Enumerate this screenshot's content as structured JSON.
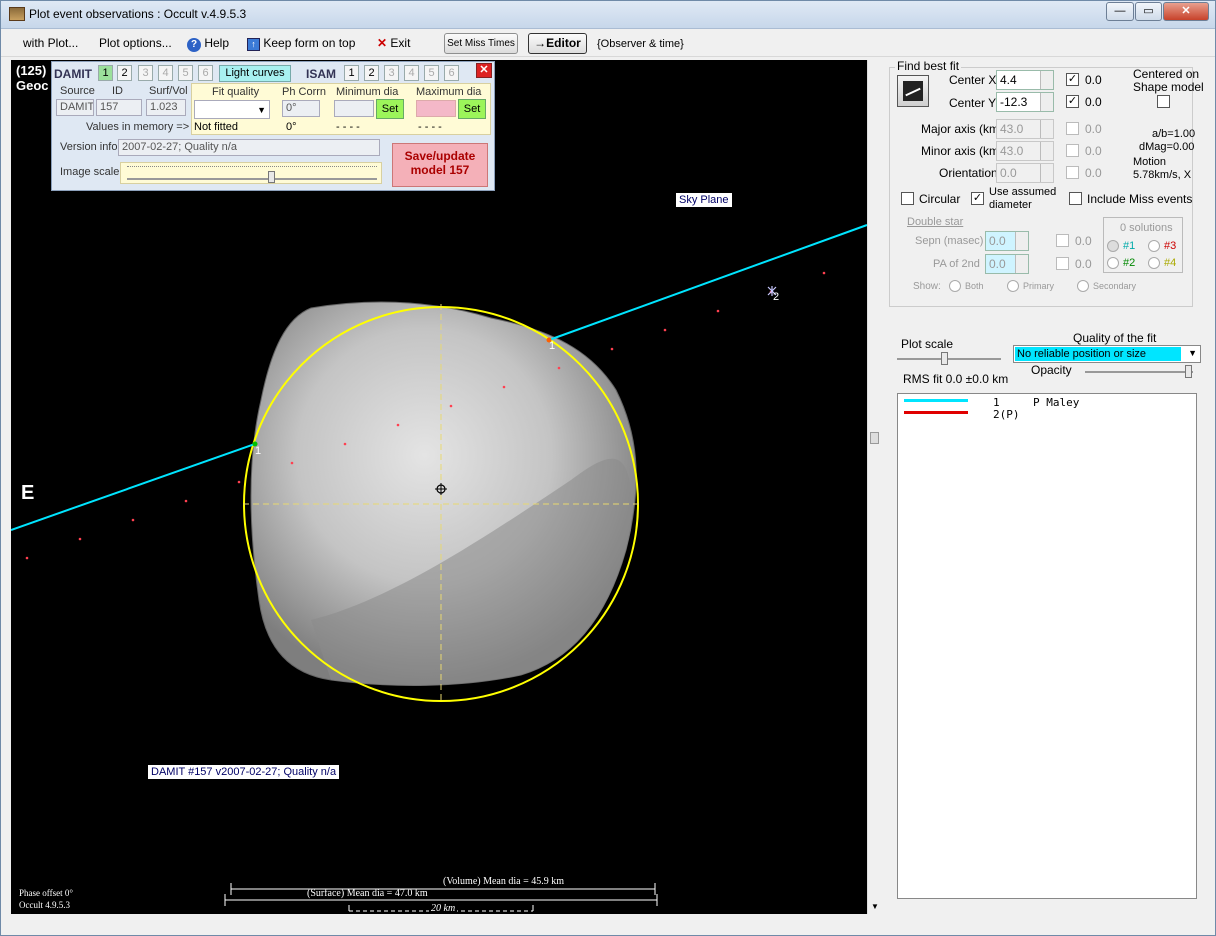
{
  "window": {
    "title": "Plot event observations : Occult v.4.9.5.3"
  },
  "menu": {
    "with_plot": "with Plot...",
    "plot_options": "Plot options...",
    "help": "Help",
    "keep_on_top": "Keep form on top",
    "exit": "Exit",
    "set_miss_times": "Set Miss Times",
    "editor": "→Editor",
    "observer_time": "{Observer & time}"
  },
  "plot": {
    "asteroid_id": "(125)",
    "geoc": "Geoc",
    "sky_plane": "Sky Plane",
    "east": "E",
    "chord1_label": "1",
    "chord1_label_b": "1",
    "chord2_label": "2",
    "model_caption": "DAMIT #157 v2007-02-27; Quality n/a",
    "volume_mean": "(Volume) Mean dia = 45.9 km",
    "surface_mean": "(Surface) Mean dia = 47.0 km",
    "scale_bar": "20 km",
    "phase_offset": "Phase offset 0°",
    "version": "Occult 4.9.5.3"
  },
  "damit": {
    "label": "DAMIT",
    "buttons": [
      "1",
      "2",
      "3",
      "4",
      "5",
      "6"
    ],
    "light_curves": "Light curves",
    "isam_label": "ISAM",
    "isam_buttons": [
      "1",
      "2",
      "3",
      "4",
      "5",
      "6"
    ],
    "close": "✕",
    "source_label": "Source",
    "id_label": "ID",
    "surfvol_label": "Surf/Vol",
    "source": "DAMIT",
    "id": "157",
    "surfvol": "1.023",
    "fit_quality_label": "Fit quality",
    "ph_corr_label": "Ph Corrn",
    "min_dia_label": "Minimum dia",
    "max_dia_label": "Maximum dia",
    "ph_corr_value": "0°",
    "set_label": "Set",
    "values_in_memory": "Values in memory =>",
    "not_fitted": "Not fitted",
    "mem_ph": "0°",
    "mem_min": "- - - -",
    "mem_max": "- - - -",
    "version_info_label": "Version info",
    "version_info": "2007-02-27; Quality n/a",
    "image_scale_label": "Image scale",
    "save_btn_line1": "Save/update",
    "save_btn_line2": "model  157"
  },
  "fit": {
    "find_best_fit": "Find best fit",
    "center_x_label": "Center X",
    "center_x": "4.4",
    "center_x_val": "0.0",
    "center_y_label": "Center Y",
    "center_y": "-12.3",
    "center_y_val": "0.0",
    "centered_on": "Centered on",
    "shape_model": "Shape model",
    "major_axis_label": "Major axis (km)",
    "major_axis": "43.0",
    "major_val": "0.0",
    "minor_axis_label": "Minor axis (km)",
    "minor_axis": "43.0",
    "minor_val": "0.0",
    "orientation_label": "Orientation",
    "orientation": "0.0",
    "orient_val": "0.0",
    "ab": "a/b=1.00",
    "dmag": "dMag=0.00",
    "motion_label": "Motion",
    "motion": "5.78km/s, X",
    "circular": "Circular",
    "use_assumed_1": "Use assumed",
    "use_assumed_2": "diameter",
    "include_miss": "Include Miss events",
    "double_star": "Double star",
    "sepn_label": "Sepn (masec)",
    "sepn": "0.0",
    "sepn_val": "0.0",
    "pa_label": "PA of 2nd",
    "pa": "0.0",
    "pa_val": "0.0",
    "show_label": "Show:",
    "show_both": "Both",
    "show_primary": "Primary",
    "show_secondary": "Secondary",
    "solutions_title": "0 solutions",
    "sol1": "#1",
    "sol2": "#2",
    "sol3": "#3",
    "sol4": "#4",
    "plot_scale": "Plot scale",
    "quality_label": "Quality of the fit",
    "quality_value": "No reliable position or size",
    "opacity": "Opacity",
    "rms": "RMS fit 0.0 ±0.0 km"
  },
  "legend": [
    {
      "num": "1",
      "name": "P Maley",
      "color": "#00e5ff"
    },
    {
      "num": "2(P)",
      "name": "",
      "color": "#e00000"
    }
  ]
}
